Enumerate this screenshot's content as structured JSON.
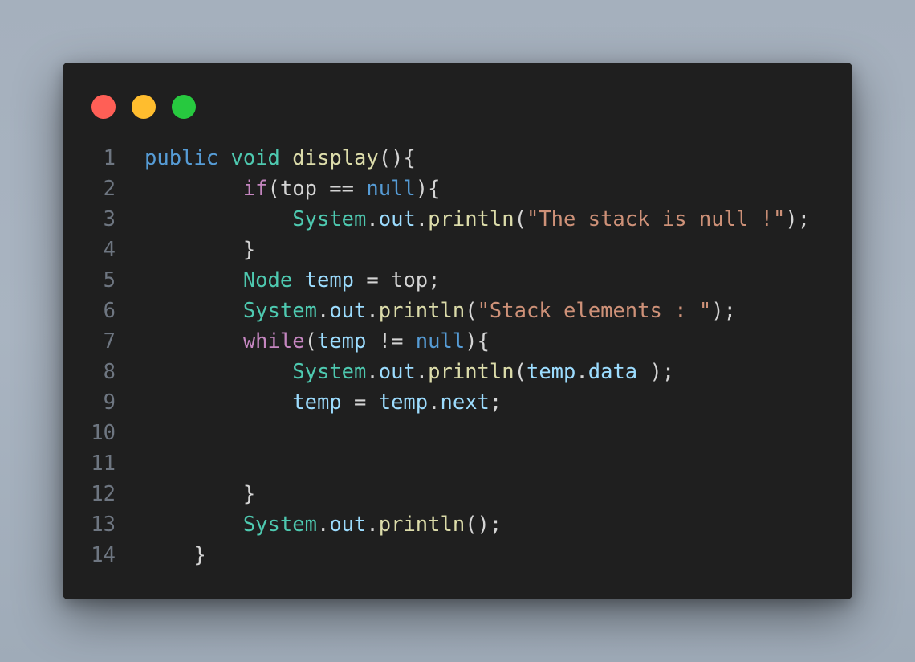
{
  "window": {
    "controls": {
      "close_color": "#ff5f56",
      "minimize_color": "#ffbd2e",
      "maximize_color": "#27c93f"
    }
  },
  "editor": {
    "language": "java",
    "colors": {
      "background": "#1f1f1f",
      "line_number": "#6e7681",
      "keyword": "#569cd6",
      "control_keyword": "#c586c0",
      "type": "#4ec9b0",
      "function": "#dcdcaa",
      "variable": "#9cdcfe",
      "string": "#ce9178",
      "text": "#d4d4d4"
    },
    "lines": [
      {
        "n": "1",
        "tokens": [
          {
            "t": "public",
            "c": "k-blue"
          },
          {
            "t": " ",
            "c": "plain"
          },
          {
            "t": "void",
            "c": "type"
          },
          {
            "t": " ",
            "c": "plain"
          },
          {
            "t": "display",
            "c": "fn"
          },
          {
            "t": "(){",
            "c": "plain"
          }
        ]
      },
      {
        "n": "2",
        "tokens": [
          {
            "t": "        ",
            "c": "plain"
          },
          {
            "t": "if",
            "c": "k-purple"
          },
          {
            "t": "(top == ",
            "c": "plain"
          },
          {
            "t": "null",
            "c": "k-blue"
          },
          {
            "t": "){",
            "c": "plain"
          }
        ]
      },
      {
        "n": "3",
        "tokens": [
          {
            "t": "            ",
            "c": "plain"
          },
          {
            "t": "System",
            "c": "type"
          },
          {
            "t": ".",
            "c": "plain"
          },
          {
            "t": "out",
            "c": "var"
          },
          {
            "t": ".",
            "c": "plain"
          },
          {
            "t": "println",
            "c": "fn"
          },
          {
            "t": "(",
            "c": "plain"
          },
          {
            "t": "\"The stack is null !\"",
            "c": "str"
          },
          {
            "t": ");",
            "c": "plain"
          }
        ]
      },
      {
        "n": "4",
        "tokens": [
          {
            "t": "        }",
            "c": "plain"
          }
        ]
      },
      {
        "n": "5",
        "tokens": [
          {
            "t": "        ",
            "c": "plain"
          },
          {
            "t": "Node",
            "c": "type"
          },
          {
            "t": " ",
            "c": "plain"
          },
          {
            "t": "temp",
            "c": "var"
          },
          {
            "t": " = top;",
            "c": "plain"
          }
        ]
      },
      {
        "n": "6",
        "tokens": [
          {
            "t": "        ",
            "c": "plain"
          },
          {
            "t": "System",
            "c": "type"
          },
          {
            "t": ".",
            "c": "plain"
          },
          {
            "t": "out",
            "c": "var"
          },
          {
            "t": ".",
            "c": "plain"
          },
          {
            "t": "println",
            "c": "fn"
          },
          {
            "t": "(",
            "c": "plain"
          },
          {
            "t": "\"Stack elements : \"",
            "c": "str"
          },
          {
            "t": ");",
            "c": "plain"
          }
        ]
      },
      {
        "n": "7",
        "tokens": [
          {
            "t": "        ",
            "c": "plain"
          },
          {
            "t": "while",
            "c": "k-purple"
          },
          {
            "t": "(",
            "c": "plain"
          },
          {
            "t": "temp",
            "c": "var"
          },
          {
            "t": " != ",
            "c": "plain"
          },
          {
            "t": "null",
            "c": "k-blue"
          },
          {
            "t": "){",
            "c": "plain"
          }
        ]
      },
      {
        "n": "8",
        "tokens": [
          {
            "t": "            ",
            "c": "plain"
          },
          {
            "t": "System",
            "c": "type"
          },
          {
            "t": ".",
            "c": "plain"
          },
          {
            "t": "out",
            "c": "var"
          },
          {
            "t": ".",
            "c": "plain"
          },
          {
            "t": "println",
            "c": "fn"
          },
          {
            "t": "(",
            "c": "plain"
          },
          {
            "t": "temp",
            "c": "var"
          },
          {
            "t": ".",
            "c": "plain"
          },
          {
            "t": "data",
            "c": "var"
          },
          {
            "t": " );",
            "c": "plain"
          }
        ]
      },
      {
        "n": "9",
        "tokens": [
          {
            "t": "            ",
            "c": "plain"
          },
          {
            "t": "temp",
            "c": "var"
          },
          {
            "t": " = ",
            "c": "plain"
          },
          {
            "t": "temp",
            "c": "var"
          },
          {
            "t": ".",
            "c": "plain"
          },
          {
            "t": "next",
            "c": "var"
          },
          {
            "t": ";",
            "c": "plain"
          }
        ]
      },
      {
        "n": "10",
        "tokens": []
      },
      {
        "n": "11",
        "tokens": []
      },
      {
        "n": "12",
        "tokens": [
          {
            "t": "        }",
            "c": "plain"
          }
        ]
      },
      {
        "n": "13",
        "tokens": [
          {
            "t": "        ",
            "c": "plain"
          },
          {
            "t": "System",
            "c": "type"
          },
          {
            "t": ".",
            "c": "plain"
          },
          {
            "t": "out",
            "c": "var"
          },
          {
            "t": ".",
            "c": "plain"
          },
          {
            "t": "println",
            "c": "fn"
          },
          {
            "t": "();",
            "c": "plain"
          }
        ]
      },
      {
        "n": "14",
        "tokens": [
          {
            "t": "    }",
            "c": "plain"
          }
        ]
      }
    ]
  }
}
